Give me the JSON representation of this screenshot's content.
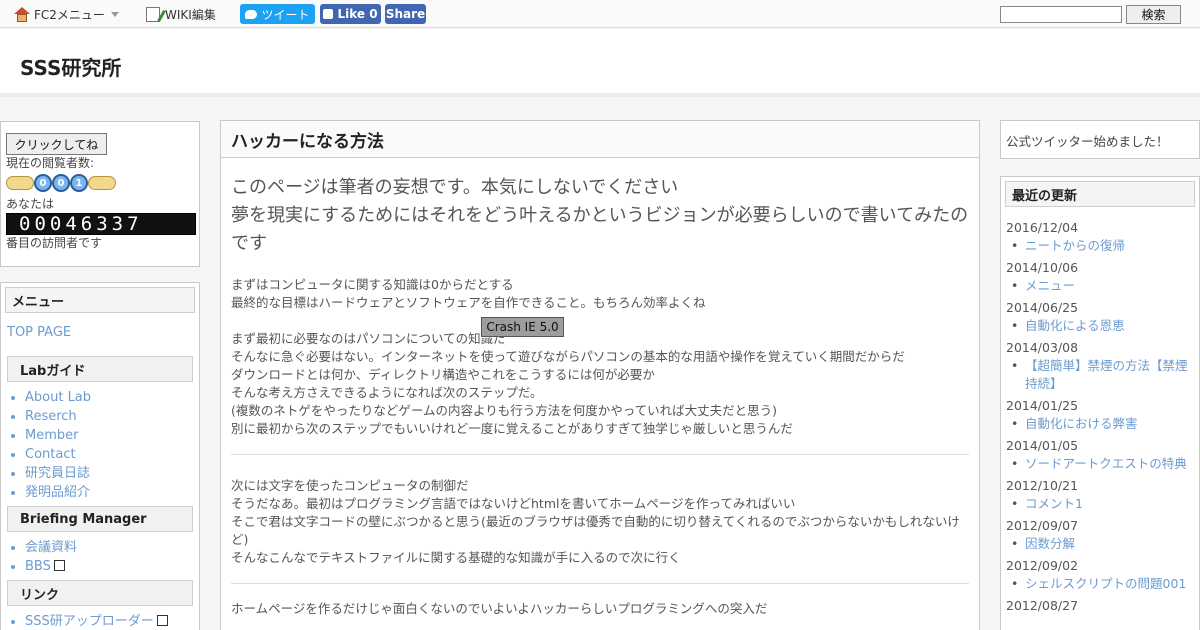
{
  "toolbar": {
    "fc2_menu": "FC2メニュー",
    "wiki_edit": "WIKI編集",
    "tweet": "ツイート",
    "like": "Like 0",
    "share": "Share",
    "search_button": "検索",
    "search_value": ""
  },
  "header": {
    "site_title": "SSS研究所"
  },
  "counter": {
    "click_button": "クリックしてね",
    "viewers_label": "現在の閲覧者数:",
    "viewer_digits": [
      "0",
      "0",
      "1"
    ],
    "you_are": "あなたは",
    "odometer": "00046337",
    "visitor_suffix": "番目の訪問者です"
  },
  "menu": {
    "title": "メニュー",
    "top_page": "TOP PAGE",
    "lab_guide": "Labガイド",
    "lab_items": [
      "About Lab",
      "Reserch",
      "Member",
      "Contact",
      "研究員日誌",
      "発明品紹介"
    ],
    "briefing": "Briefing Manager",
    "briefing_items": [
      "会議資料",
      "BBS"
    ],
    "links": "リンク",
    "link_items": [
      "SSS研アップローダー"
    ]
  },
  "main": {
    "title": "ハッカーになる方法",
    "lead1": "このページは筆者の妄想です。本気にしないでください",
    "lead2": "夢を現実にするためにはそれをどう叶えるかというビジョンが必要らしいので書いてみたのです",
    "p1": [
      "まずはコンピュータに関する知識は0からだとする",
      "最終的な目標はハードウェアとソフトウェアを自作できること。もちろん効率よくね"
    ],
    "p2": [
      "まず最初に必要なのはパソコンについての知識だ",
      "そんなに急ぐ必要はない。インターネットを使って遊びながらパソコンの基本的な用語や操作を覚えていく期間だからだ",
      "ダウンロードとは何か、ディレクトリ構造やこれをこうするには何が必要か",
      "そんな考え方さえできるようになれば次のステップだ。",
      "(複数のネトゲをやったりなどゲームの内容よりも行う方法を何度かやっていれば大丈夫だと思う)",
      "別に最初から次のステップでもいいけれど一度に覚えることがありすぎて独学じゃ厳しいと思うんだ"
    ],
    "p3": [
      "次には文字を使ったコンピュータの制御だ",
      "そうだなあ。最初はプログラミング言語ではないけどhtmlを書いてホームページを作ってみればいい",
      "そこで君は文字コードの壁にぶつかると思う(最近のブラウザは優秀で自動的に切り替えてくれるのでぶつからないかもしれないけど)",
      "そんなこんなでテキストファイルに関する基礎的な知識が手に入るので次に行く"
    ],
    "p4": [
      "ホームページを作るだけじゃ面白くないのでいよいよハッカーらしいプログラミングへの突入だ"
    ],
    "crash_button": "Crash IE 5.0"
  },
  "sidebar_right": {
    "twitter_text": "公式ツイッター始めました！",
    "recent_title": "最近の更新",
    "recent": [
      {
        "date": "2016/12/04",
        "title": "ニートからの復帰"
      },
      {
        "date": "2014/10/06",
        "title": "メニュー"
      },
      {
        "date": "2014/06/25",
        "title": "自動化による恩恵"
      },
      {
        "date": "2014/03/08",
        "title": "【超簡単】禁煙の方法【禁煙　持続】"
      },
      {
        "date": "2014/01/25",
        "title": "自動化における弊害"
      },
      {
        "date": "2014/01/05",
        "title": "ソードアートクエストの特典"
      },
      {
        "date": "2012/10/21",
        "title": "コメント1"
      },
      {
        "date": "2012/09/07",
        "title": "因数分解"
      },
      {
        "date": "2012/09/02",
        "title": "シェルスクリプトの問題001"
      },
      {
        "date": "2012/08/27",
        "title": ""
      }
    ]
  }
}
